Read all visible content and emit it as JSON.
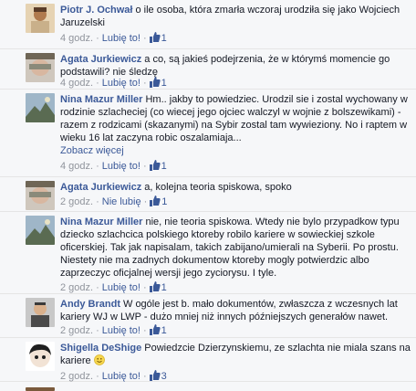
{
  "comments": [
    {
      "author": "Piotr J. Ochwał",
      "text": "o ile osoba, która zmarła wczoraj urodziła się jako Wojciech Jaruzelski",
      "time": "4 godz.",
      "action": "Lubię to!",
      "likes": "1"
    },
    {
      "author": "Agata Jurkiewicz",
      "text": "a co, są jakieś podejrzenia, że w którymś momencie go podstawili? nie śledzę",
      "time": "4 godz.",
      "action": "Lubię to!",
      "likes": "1"
    },
    {
      "author": "Nina Mazur Miller",
      "text": "Hm.. jakby to powiedziec. Urodzil sie i zostal wychowany w rodzinie szlacheciej (co wiecej jego ojciec walczyl w wojnie z bolszewikami) - razem z rodzicami (skazanymi) na Sybir zostal tam wywieziony. No i raptem w wieku 16 lat zaczyna robic oszalamiaja...",
      "more": "Zobacz więcej",
      "time": "4 godz.",
      "action": "Lubię to!",
      "likes": "1"
    },
    {
      "author": "Agata Jurkiewicz",
      "text": "a, kolejna teoria spiskowa, spoko",
      "time": "2 godz.",
      "action": "Nie lubię",
      "likes": "1"
    },
    {
      "author": "Nina Mazur Miller",
      "text": "nie, nie teoria spiskowa. Wtedy nie bylo przypadkow typu dziecko szlachcica polskiego ktoreby robilo kariere w sowieckiej szkole oficerskiej. Tak jak napisalam, takich zabijano/umierali na Syberii. Po prostu. Niestety nie ma zadnych dokumentow ktoreby mogly potwierdzic albo zaprzeczyc oficjalnej wersji jego zyciorysu. I tyle.",
      "time": "2 godz.",
      "action": "Lubię to!",
      "likes": "1"
    },
    {
      "author": "Andy Brandt",
      "text": "W ogóle jest b. mało dokumentów, zwłaszcza z wczesnych lat kariery WJ w LWP - dużo mniej niż innych późniejszych generałów nawet.",
      "time": "2 godz.",
      "action": "Lubię to!",
      "likes": "1"
    },
    {
      "author": "Shigella DeShige",
      "text": "Powiedzcie Dzierzynskiemu, ze szlachta nie miala szans na kariere",
      "time": "2 godz.",
      "action": "Lubię to!",
      "likes": "3"
    }
  ],
  "icons": {
    "like": "thumbs-up-icon",
    "emoji": "smiley-icon"
  },
  "colors": {
    "link": "#3b5998",
    "meta": "#90949c",
    "background": "#f6f7f9"
  }
}
